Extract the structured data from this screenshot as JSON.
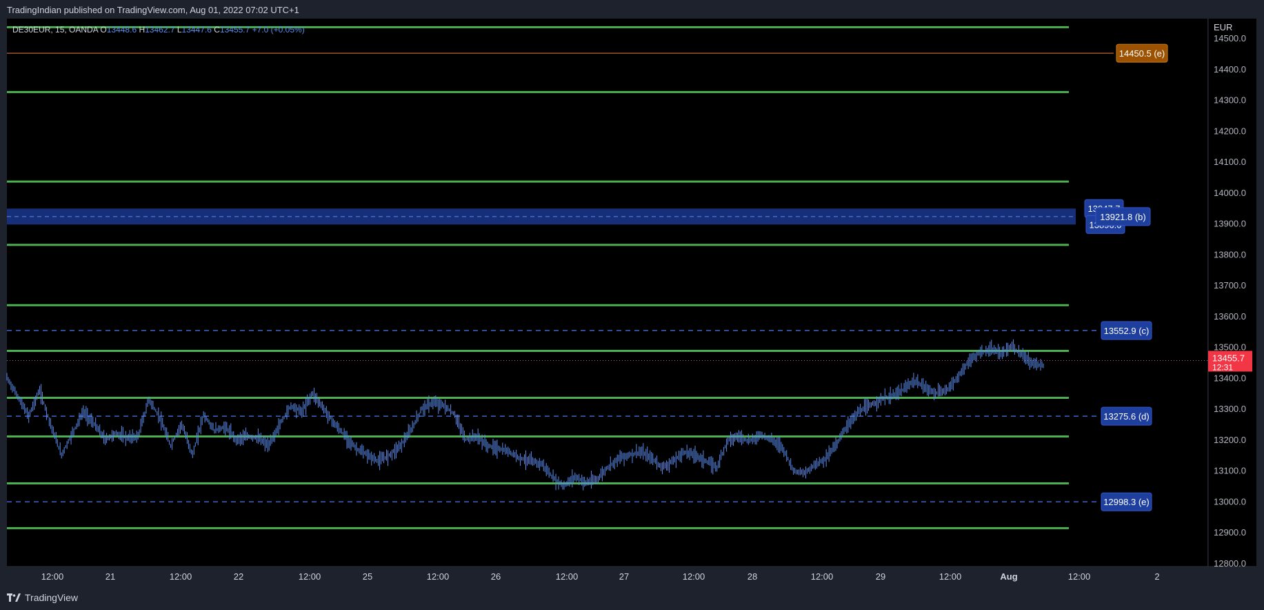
{
  "header": {
    "published_text": "TradingIndian published on TradingView.com, Aug 01, 2022 07:02 UTC+1"
  },
  "footer": {
    "brand": "TradingView"
  },
  "colors": {
    "background": "#000000",
    "frame": "#1e222d",
    "candle": "#5b8def",
    "support_line": "#4caf50",
    "resistance_e_line": "#a0522d",
    "zone_fill": "#1e3fa0",
    "label_blue": "#1e3f9e",
    "label_orange": "#9c5200",
    "current_price": "#f23645"
  },
  "chart_data": {
    "type": "candlestick",
    "instrument": {
      "symbol": "DE30EUR",
      "interval": "15",
      "source": "OANDA",
      "open_label": "O",
      "open": "13448.6",
      "high_label": "H",
      "high": "13462.7",
      "low_label": "L",
      "low": "13447.6",
      "close_label": "C",
      "close": "13455.7",
      "change": "+7.0 (+0.05%)"
    },
    "currency": "EUR",
    "ylim": [
      12780,
      14560
    ],
    "y_ticks": [
      "14500.0",
      "14400.0",
      "14300.0",
      "14200.0",
      "14100.0",
      "14000.0",
      "13900.0",
      "13800.0",
      "13700.0",
      "13600.0",
      "13500.0",
      "13400.0",
      "13300.0",
      "13200.0",
      "13100.0",
      "13000.0",
      "12900.0",
      "12800.0"
    ],
    "x_ticks": [
      "12:00",
      "21",
      "12:00",
      "22",
      "12:00",
      "25",
      "12:00",
      "26",
      "12:00",
      "27",
      "12:00",
      "28",
      "12:00",
      "29",
      "12:00",
      "Aug",
      "12:00",
      "2"
    ],
    "series": [
      {
        "values": [
          [
            0,
            13400
          ],
          [
            8,
            13340
          ],
          [
            16,
            13275
          ],
          [
            24,
            13360
          ],
          [
            32,
            13250
          ],
          [
            40,
            13150
          ],
          [
            48,
            13220
          ],
          [
            56,
            13290
          ],
          [
            64,
            13250
          ],
          [
            72,
            13200
          ],
          [
            80,
            13220
          ],
          [
            88,
            13205
          ],
          [
            96,
            13210
          ],
          [
            104,
            13330
          ],
          [
            112,
            13270
          ],
          [
            120,
            13180
          ],
          [
            128,
            13250
          ],
          [
            136,
            13150
          ],
          [
            144,
            13280
          ],
          [
            152,
            13230
          ],
          [
            160,
            13240
          ],
          [
            168,
            13200
          ],
          [
            176,
            13210
          ],
          [
            184,
            13205
          ],
          [
            192,
            13180
          ],
          [
            200,
            13250
          ],
          [
            208,
            13310
          ],
          [
            216,
            13290
          ],
          [
            224,
            13350
          ],
          [
            232,
            13300
          ],
          [
            240,
            13250
          ],
          [
            248,
            13210
          ],
          [
            256,
            13170
          ],
          [
            264,
            13150
          ],
          [
            272,
            13130
          ],
          [
            280,
            13150
          ],
          [
            288,
            13180
          ],
          [
            296,
            13230
          ],
          [
            304,
            13300
          ],
          [
            312,
            13320
          ],
          [
            320,
            13310
          ],
          [
            328,
            13280
          ],
          [
            336,
            13200
          ],
          [
            344,
            13210
          ],
          [
            352,
            13180
          ],
          [
            360,
            13170
          ],
          [
            368,
            13160
          ],
          [
            376,
            13140
          ],
          [
            384,
            13130
          ],
          [
            392,
            13120
          ],
          [
            400,
            13075
          ],
          [
            408,
            13050
          ],
          [
            416,
            13080
          ],
          [
            424,
            13060
          ],
          [
            432,
            13070
          ],
          [
            440,
            13110
          ],
          [
            448,
            13140
          ],
          [
            456,
            13150
          ],
          [
            464,
            13160
          ],
          [
            472,
            13140
          ],
          [
            480,
            13110
          ],
          [
            488,
            13130
          ],
          [
            496,
            13160
          ],
          [
            504,
            13150
          ],
          [
            512,
            13130
          ],
          [
            520,
            13110
          ],
          [
            528,
            13200
          ],
          [
            536,
            13210
          ],
          [
            544,
            13195
          ],
          [
            552,
            13215
          ],
          [
            560,
            13200
          ],
          [
            568,
            13175
          ],
          [
            576,
            13100
          ],
          [
            584,
            13090
          ],
          [
            592,
            13120
          ],
          [
            600,
            13140
          ],
          [
            608,
            13190
          ],
          [
            616,
            13250
          ],
          [
            624,
            13290
          ],
          [
            632,
            13310
          ],
          [
            640,
            13330
          ],
          [
            648,
            13340
          ],
          [
            656,
            13360
          ],
          [
            664,
            13390
          ],
          [
            672,
            13370
          ],
          [
            680,
            13350
          ],
          [
            688,
            13360
          ],
          [
            696,
            13400
          ],
          [
            704,
            13450
          ],
          [
            712,
            13480
          ],
          [
            720,
            13490
          ],
          [
            728,
            13480
          ],
          [
            736,
            13500
          ],
          [
            744,
            13470
          ],
          [
            752,
            13445
          ],
          [
            760,
            13440
          ]
        ]
      }
    ],
    "horizontal_levels": [
      {
        "price": 14535,
        "kind": "support"
      },
      {
        "price": 14450.5,
        "kind": "level_e_upper",
        "label": "14450.5 (e)"
      },
      {
        "price": 14325,
        "kind": "support"
      },
      {
        "price": 14035,
        "kind": "support"
      },
      {
        "price": 13830,
        "kind": "support"
      },
      {
        "price": 13635,
        "kind": "support"
      },
      {
        "price": 13552.9,
        "kind": "dashed",
        "label": "13552.9 (c)"
      },
      {
        "price": 13487,
        "kind": "support"
      },
      {
        "price": 13335,
        "kind": "support"
      },
      {
        "price": 13275.6,
        "kind": "dashed",
        "label": "13275.6 (d)"
      },
      {
        "price": 13210,
        "kind": "support"
      },
      {
        "price": 13058,
        "kind": "support"
      },
      {
        "price": 12998.3,
        "kind": "dashed",
        "label": "12998.3 (e)"
      },
      {
        "price": 12913,
        "kind": "support"
      }
    ],
    "zone": {
      "top": 13947.7,
      "bottom": 13896.0,
      "mid": 13921.8,
      "top_label": "13947.7",
      "bottom_label": "13896.0",
      "mid_label": "13921.8 (b)"
    },
    "current_price": {
      "price": 13455.7,
      "label": "13455.7",
      "countdown": "12:31"
    }
  }
}
